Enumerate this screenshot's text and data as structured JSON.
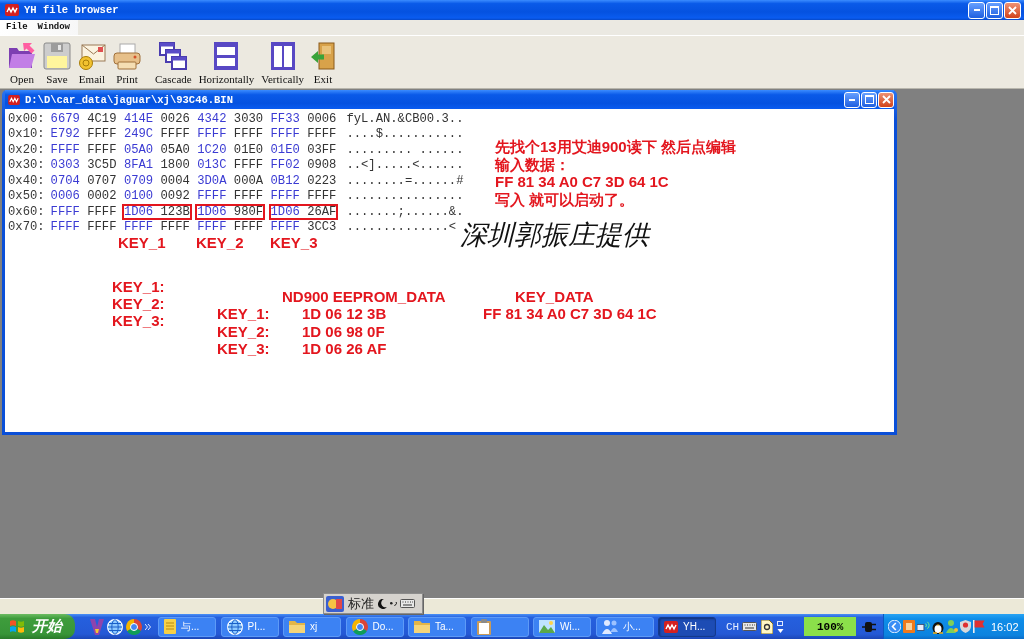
{
  "window": {
    "title": "YH file browser"
  },
  "menu": [
    "File",
    "Window"
  ],
  "toolbar": [
    [
      "Open",
      "Save",
      "Email",
      "Print"
    ],
    [
      "Cascade",
      "Horizontally",
      "Vertically",
      "Exit"
    ]
  ],
  "document": {
    "title": "D:\\D\\car_data\\jaguar\\xj\\93C46.BIN",
    "rows": [
      {
        "offset": "0x00:",
        "pairs": [
          {
            "words": [
              "6679",
              "4C19"
            ],
            "boxed": false
          },
          {
            "words": [
              "414E",
              "0026"
            ],
            "boxed": false
          },
          {
            "words": [
              "4342",
              "3030"
            ],
            "boxed": false
          },
          {
            "words": [
              "FF33",
              "0006"
            ],
            "boxed": false
          }
        ],
        "ascii": "fyL.AN.&CB00.3.."
      },
      {
        "offset": "0x10:",
        "pairs": [
          {
            "words": [
              "E792",
              "FFFF"
            ],
            "boxed": false
          },
          {
            "words": [
              "249C",
              "FFFF"
            ],
            "boxed": false
          },
          {
            "words": [
              "FFFF",
              "FFFF"
            ],
            "boxed": false
          },
          {
            "words": [
              "FFFF",
              "FFFF"
            ],
            "boxed": false
          }
        ],
        "ascii": "....$..........."
      },
      {
        "offset": "0x20:",
        "pairs": [
          {
            "words": [
              "FFFF",
              "FFFF"
            ],
            "boxed": false
          },
          {
            "words": [
              "05A0",
              "05A0"
            ],
            "boxed": false
          },
          {
            "words": [
              "1C20",
              "01E0"
            ],
            "boxed": false
          },
          {
            "words": [
              "01E0",
              "03FF"
            ],
            "boxed": false
          }
        ],
        "ascii": "......... ......"
      },
      {
        "offset": "0x30:",
        "pairs": [
          {
            "words": [
              "0303",
              "3C5D"
            ],
            "boxed": false
          },
          {
            "words": [
              "8FA1",
              "1800"
            ],
            "boxed": false
          },
          {
            "words": [
              "013C",
              "FFFF"
            ],
            "boxed": false
          },
          {
            "words": [
              "FF02",
              "0908"
            ],
            "boxed": false
          }
        ],
        "ascii": "..<].....<......"
      },
      {
        "offset": "0x40:",
        "pairs": [
          {
            "words": [
              "0704",
              "0707"
            ],
            "boxed": false
          },
          {
            "words": [
              "0709",
              "0004"
            ],
            "boxed": false
          },
          {
            "words": [
              "3D0A",
              "000A"
            ],
            "boxed": false
          },
          {
            "words": [
              "0B12",
              "0223"
            ],
            "boxed": false
          }
        ],
        "ascii": "........=......#"
      },
      {
        "offset": "0x50:",
        "pairs": [
          {
            "words": [
              "0006",
              "0002"
            ],
            "boxed": false
          },
          {
            "words": [
              "0100",
              "0092"
            ],
            "boxed": false
          },
          {
            "words": [
              "FFFF",
              "FFFF"
            ],
            "boxed": false
          },
          {
            "words": [
              "FFFF",
              "FFFF"
            ],
            "boxed": false
          }
        ],
        "ascii": "................"
      },
      {
        "offset": "0x60:",
        "pairs": [
          {
            "words": [
              "FFFF",
              "FFFF"
            ],
            "boxed": false
          },
          {
            "words": [
              "1D06",
              "123B"
            ],
            "boxed": true
          },
          {
            "words": [
              "1D06",
              "980F"
            ],
            "boxed": true
          },
          {
            "words": [
              "1D06",
              "26AF"
            ],
            "boxed": true
          }
        ],
        "ascii": ".......;......&."
      },
      {
        "offset": "0x70:",
        "pairs": [
          {
            "words": [
              "FFFF",
              "FFFF"
            ],
            "boxed": false
          },
          {
            "words": [
              "FFFF",
              "FFFF"
            ],
            "boxed": false
          },
          {
            "words": [
              "FFFF",
              "FFFF"
            ],
            "boxed": false
          },
          {
            "words": [
              "FFFF",
              "3CC3"
            ],
            "boxed": false
          }
        ],
        "ascii": "..............<"
      }
    ]
  },
  "annotations": {
    "instructions": [
      "先找个13用艾迪900读下 然后点编辑",
      "输入数据：",
      "FF 81 34 A0 C7 3D 64 1C",
      "写入 就可以启动了。"
    ],
    "credit": "深圳郭振庄提供",
    "key_markers": [
      "KEY_1",
      "KEY_2",
      "KEY_3"
    ],
    "key_list": [
      "KEY_1:",
      "KEY_2:",
      "KEY_3:"
    ],
    "key_table": {
      "columns": [
        "ND900 EEPROM_DATA",
        "KEY_DATA"
      ],
      "rows": [
        {
          "label": "KEY_1:",
          "eeprom_data": "1D 06 12 3B",
          "key_data": "FF 81 34 A0 C7 3D 64 1C"
        },
        {
          "label": "KEY_2:",
          "eeprom_data": "1D 06 98 0F"
        },
        {
          "label": "KEY_3:",
          "eeprom_data": "1D 06 26 AF"
        }
      ]
    }
  },
  "ime_bar": {
    "mode": "标准"
  },
  "taskbar": {
    "start": "开始",
    "tasks": [
      {
        "label": "与...",
        "selected": false
      },
      {
        "label": "PI...",
        "selected": false
      },
      {
        "label": "xj",
        "selected": false
      },
      {
        "label": "Do...",
        "selected": false
      },
      {
        "label": "Ta...",
        "selected": false
      },
      {
        "selected": false
      },
      {
        "label": "Wi...",
        "selected": false
      },
      {
        "label": "小...",
        "selected": false
      },
      {
        "label": "YH...",
        "selected": true
      }
    ],
    "language": "CH",
    "zoom": "100%",
    "clock": "16:02"
  }
}
